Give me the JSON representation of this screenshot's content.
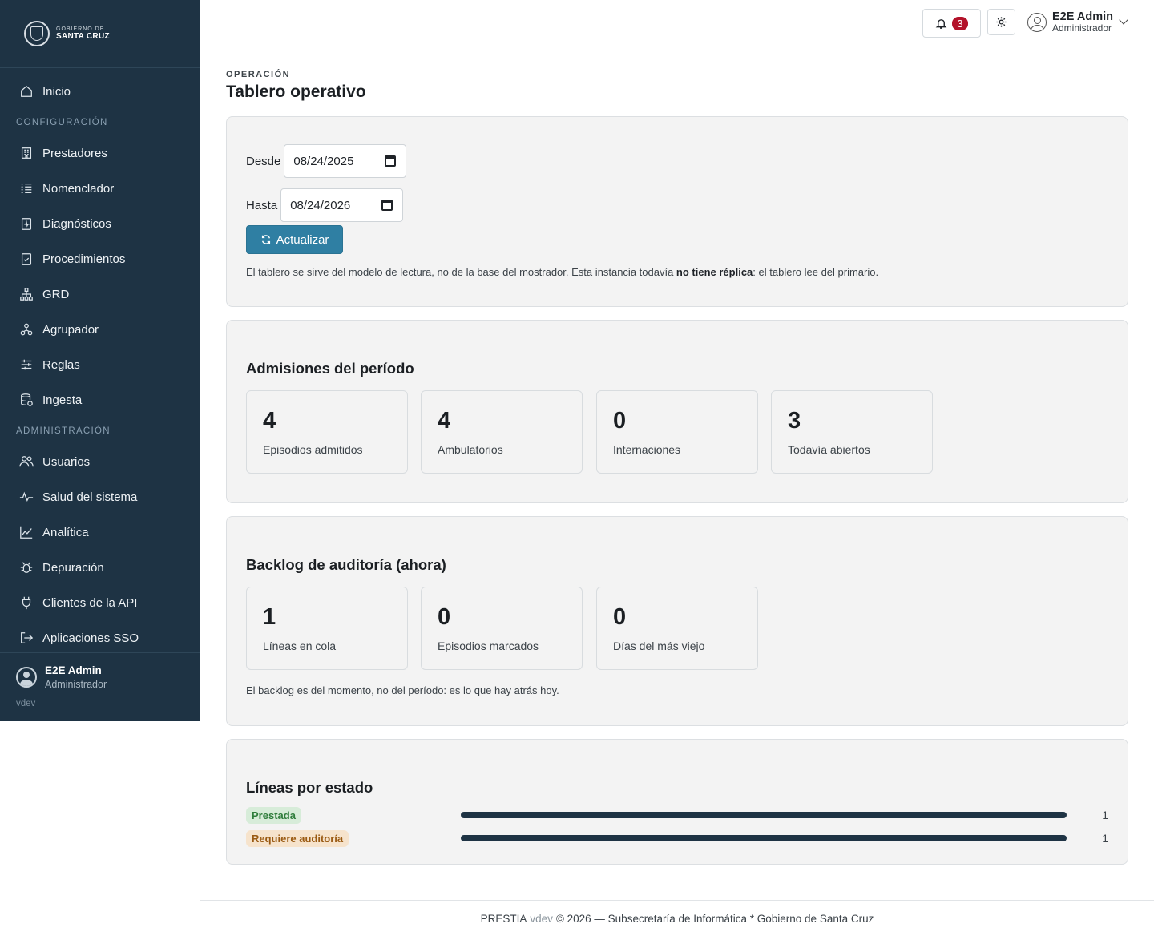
{
  "sidebar": {
    "logo": {
      "line1": "GOBIERNO DE",
      "line2": "SANTA CRUZ"
    },
    "items_top": [
      {
        "label": "Inicio",
        "icon": "home-icon"
      }
    ],
    "section_config": "CONFIGURACIÓN",
    "items_config": [
      {
        "label": "Prestadores",
        "icon": "building-icon"
      },
      {
        "label": "Nomenclador",
        "icon": "list-icon"
      },
      {
        "label": "Diagnósticos",
        "icon": "clipboard-pulse-icon"
      },
      {
        "label": "Procedimientos",
        "icon": "clipboard-check-icon"
      },
      {
        "label": "GRD",
        "icon": "hierarchy-icon"
      },
      {
        "label": "Agrupador",
        "icon": "group-icon"
      },
      {
        "label": "Reglas",
        "icon": "sliders-icon"
      },
      {
        "label": "Ingesta",
        "icon": "database-icon"
      }
    ],
    "section_admin": "ADMINISTRACIÓN",
    "items_admin": [
      {
        "label": "Usuarios",
        "icon": "users-icon"
      },
      {
        "label": "Salud del sistema",
        "icon": "pulse-icon"
      },
      {
        "label": "Analítica",
        "icon": "chart-line-icon"
      },
      {
        "label": "Depuración",
        "icon": "bug-icon"
      },
      {
        "label": "Clientes de la API",
        "icon": "plug-icon"
      },
      {
        "label": "Aplicaciones SSO",
        "icon": "login-icon"
      }
    ],
    "user": {
      "name": "E2E Admin",
      "role": "Administrador"
    },
    "version": "vdev"
  },
  "topbar": {
    "notifications_count": "3",
    "user": {
      "name": "E2E Admin",
      "role": "Administrador"
    }
  },
  "page": {
    "eyebrow": "OPERACIÓN",
    "title": "Tablero operativo"
  },
  "filters": {
    "from_label": "Desde",
    "from_value": "08/24/2025",
    "to_label": "Hasta",
    "to_value": "08/24/2026",
    "update_button": "Actualizar",
    "note_before": "El tablero se sirve del modelo de lectura, no de la base del mostrador. Esta instancia todavía ",
    "note_bold": "no tiene réplica",
    "note_after": ": el tablero lee del primario."
  },
  "admissions": {
    "title": "Admisiones del período",
    "stats": [
      {
        "value": "4",
        "label": "Episodios admitidos"
      },
      {
        "value": "4",
        "label": "Ambulatorios"
      },
      {
        "value": "0",
        "label": "Internaciones"
      },
      {
        "value": "3",
        "label": "Todavía abiertos"
      }
    ]
  },
  "backlog": {
    "title": "Backlog de auditoría (ahora)",
    "stats": [
      {
        "value": "1",
        "label": "Líneas en cola"
      },
      {
        "value": "0",
        "label": "Episodios marcados"
      },
      {
        "value": "0",
        "label": "Días del más viejo"
      }
    ],
    "note": "El backlog es del momento, no del período: es lo que hay atrás hoy."
  },
  "lines_by_status": {
    "title": "Líneas por estado",
    "rows": [
      {
        "status": "Prestada",
        "count": "1",
        "fraction": 1.0,
        "color": "#2f7d3c"
      },
      {
        "status": "Requiere auditoría",
        "count": "1",
        "fraction": 1.0,
        "color": "#9a5a12"
      }
    ]
  },
  "footer": {
    "brand": "PRESTIA",
    "version": "vdev",
    "rest": "© 2026 — Subsecretaría de Informática * Gobierno de Santa Cruz"
  },
  "colors": {
    "sidebar_bg": "#1e3344",
    "accent_button": "#2f7fa3",
    "badge_red": "#b3122a"
  }
}
